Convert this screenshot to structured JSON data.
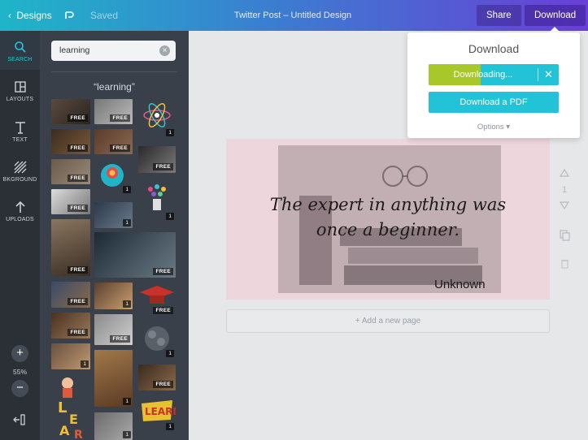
{
  "topbar": {
    "back_label": "Designs",
    "saved_label": "Saved",
    "title": "Twitter Post – Untitled Design",
    "share_label": "Share",
    "download_label": "Download"
  },
  "rail": {
    "search": "SEARCH",
    "layouts": "LAYOUTS",
    "text": "TEXT",
    "bkground": "BKGROUND",
    "uploads": "UPLOADS",
    "zoom": "55%"
  },
  "panel": {
    "search_value": "learning",
    "results_title": "“learning”",
    "free_label": "FREE",
    "count_label": "1"
  },
  "design": {
    "quote_line1": "The expert in anything was",
    "quote_line2": "once a beginner.",
    "author": "Unknown",
    "page_number": "1",
    "add_page_label": "+ Add a new page"
  },
  "download_popover": {
    "title": "Download",
    "progress_label": "Downloading...",
    "progress_fraction": 0.48,
    "pdf_label": "Download a PDF",
    "options_label": "Options ▾"
  },
  "colors": {
    "accent": "#22c3d6",
    "progress": "#a8c82a",
    "rail_active": "#27c5db"
  }
}
